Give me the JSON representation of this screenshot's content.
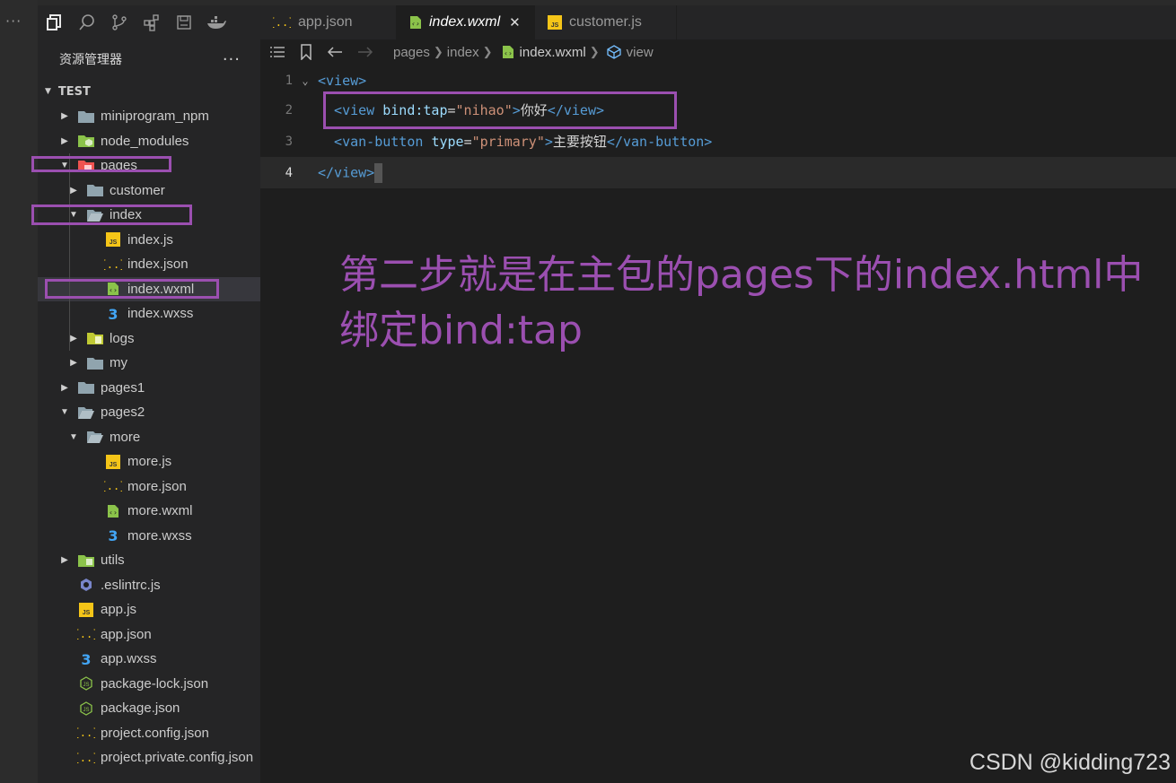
{
  "activity": {
    "more": "···"
  },
  "sidebar": {
    "title": "资源管理器",
    "more": "···",
    "section": "TEST",
    "items": [
      {
        "label": "miniprogram_npm",
        "indent": 0,
        "caret": "▶",
        "icon": "folder"
      },
      {
        "label": "node_modules",
        "indent": 0,
        "caret": "▶",
        "icon": "node-folder"
      },
      {
        "label": "pages",
        "indent": 0,
        "caret": "▼",
        "icon": "pages-folder",
        "boxed": true
      },
      {
        "label": "customer",
        "indent": 1,
        "caret": "▶",
        "icon": "folder"
      },
      {
        "label": "index",
        "indent": 1,
        "caret": "▼",
        "icon": "folder-open",
        "boxed": true
      },
      {
        "label": "index.js",
        "indent": 2,
        "caret": "",
        "icon": "js"
      },
      {
        "label": "index.json",
        "indent": 2,
        "caret": "",
        "icon": "json"
      },
      {
        "label": "index.wxml",
        "indent": 2,
        "caret": "",
        "icon": "wxml",
        "boxed": true,
        "selected": true
      },
      {
        "label": "index.wxss",
        "indent": 2,
        "caret": "",
        "icon": "css"
      },
      {
        "label": "logs",
        "indent": 1,
        "caret": "▶",
        "icon": "logs-folder"
      },
      {
        "label": "my",
        "indent": 1,
        "caret": "▶",
        "icon": "folder"
      },
      {
        "label": "pages1",
        "indent": 0,
        "caret": "▶",
        "icon": "folder"
      },
      {
        "label": "pages2",
        "indent": 0,
        "caret": "▼",
        "icon": "folder-open"
      },
      {
        "label": "more",
        "indent": 1,
        "caret": "▼",
        "icon": "folder-open"
      },
      {
        "label": "more.js",
        "indent": 2,
        "caret": "",
        "icon": "js"
      },
      {
        "label": "more.json",
        "indent": 2,
        "caret": "",
        "icon": "json"
      },
      {
        "label": "more.wxml",
        "indent": 2,
        "caret": "",
        "icon": "wxml"
      },
      {
        "label": "more.wxss",
        "indent": 2,
        "caret": "",
        "icon": "css"
      },
      {
        "label": "utils",
        "indent": 0,
        "caret": "▶",
        "icon": "utils-folder"
      },
      {
        "label": ".eslintrc.js",
        "indent": 0,
        "caret": "",
        "icon": "eslint"
      },
      {
        "label": "app.js",
        "indent": 0,
        "caret": "",
        "icon": "js"
      },
      {
        "label": "app.json",
        "indent": 0,
        "caret": "",
        "icon": "json"
      },
      {
        "label": "app.wxss",
        "indent": 0,
        "caret": "",
        "icon": "css"
      },
      {
        "label": "package-lock.json",
        "indent": 0,
        "caret": "",
        "icon": "npm"
      },
      {
        "label": "package.json",
        "indent": 0,
        "caret": "",
        "icon": "npm"
      },
      {
        "label": "project.config.json",
        "indent": 0,
        "caret": "",
        "icon": "json"
      },
      {
        "label": "project.private.config.json",
        "indent": 0,
        "caret": "",
        "icon": "json"
      }
    ]
  },
  "tabs": [
    {
      "label": "app.json",
      "icon": "json",
      "active": false
    },
    {
      "label": "index.wxml",
      "icon": "wxml",
      "active": true,
      "close": "✕"
    },
    {
      "label": "customer.js",
      "icon": "js",
      "active": false
    }
  ],
  "breadcrumbs": {
    "parts": [
      "pages",
      "index",
      "index.wxml",
      "view"
    ]
  },
  "editor": {
    "line_numbers": [
      "1",
      "2",
      "3",
      "4"
    ],
    "lines": [
      {
        "tokens": [
          {
            "t": "tag",
            "v": "<view>"
          }
        ]
      },
      {
        "tokens": [
          {
            "t": "tag",
            "v": "  <view "
          },
          {
            "t": "attr",
            "v": "bind:tap"
          },
          {
            "t": "txt",
            "v": "="
          },
          {
            "t": "str",
            "v": "\"nihao\""
          },
          {
            "t": "tag",
            "v": ">"
          },
          {
            "t": "txt",
            "v": "你好"
          },
          {
            "t": "tag",
            "v": "</view>"
          }
        ]
      },
      {
        "tokens": [
          {
            "t": "tag",
            "v": "  <van-button "
          },
          {
            "t": "attr",
            "v": "type"
          },
          {
            "t": "txt",
            "v": "="
          },
          {
            "t": "str",
            "v": "\"primary\""
          },
          {
            "t": "tag",
            "v": ">"
          },
          {
            "t": "txt",
            "v": "主要按钮"
          },
          {
            "t": "tag",
            "v": "</van-button>"
          }
        ]
      },
      {
        "tokens": [
          {
            "t": "tag",
            "v": "</view>"
          }
        ]
      }
    ]
  },
  "annotation": "第二步就是在主包的pages下的index.html中绑定bind:tap",
  "watermark": "CSDN @kidding723",
  "colors": {
    "highlight": "#9b4fb0",
    "tag": "#569cd6",
    "attr": "#9cdcfe",
    "string": "#ce9178"
  }
}
